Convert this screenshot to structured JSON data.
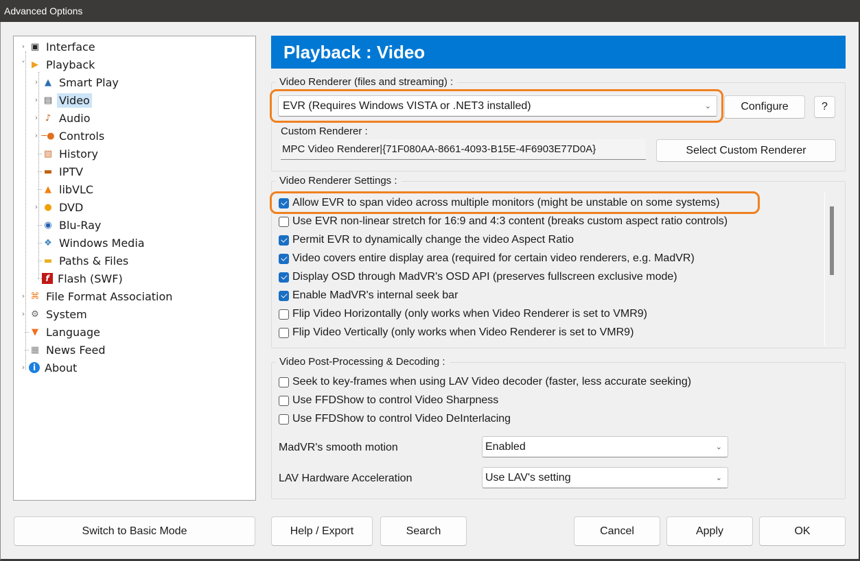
{
  "window": {
    "title": "Advanced Options"
  },
  "tree": {
    "items": [
      {
        "label": "Interface",
        "icon": "interface-icon",
        "level": 0,
        "expander": "collapsed"
      },
      {
        "label": "Playback",
        "icon": "playback-icon",
        "level": 0,
        "expander": "expanded"
      },
      {
        "label": "Smart Play",
        "icon": "smart-play-icon",
        "level": 1,
        "expander": "collapsed"
      },
      {
        "label": "Video",
        "icon": "video-icon",
        "level": 1,
        "expander": "collapsed",
        "selected": true
      },
      {
        "label": "Audio",
        "icon": "audio-icon",
        "level": 1,
        "expander": "collapsed"
      },
      {
        "label": "Controls",
        "icon": "controls-icon",
        "level": 1,
        "expander": "collapsed"
      },
      {
        "label": "History",
        "icon": "history-icon",
        "level": 1,
        "expander": "none"
      },
      {
        "label": "IPTV",
        "icon": "iptv-icon",
        "level": 1,
        "expander": "none"
      },
      {
        "label": "libVLC",
        "icon": "vlc-icon",
        "level": 1,
        "expander": "none"
      },
      {
        "label": "DVD",
        "icon": "dvd-icon",
        "level": 1,
        "expander": "collapsed"
      },
      {
        "label": "Blu-Ray",
        "icon": "bluray-icon",
        "level": 1,
        "expander": "none"
      },
      {
        "label": "Windows Media",
        "icon": "windows-media-icon",
        "level": 1,
        "expander": "none"
      },
      {
        "label": "Paths & Files",
        "icon": "folder-icon",
        "level": 1,
        "expander": "none"
      },
      {
        "label": "Flash (SWF)",
        "icon": "flash-icon",
        "level": 1,
        "expander": "none"
      },
      {
        "label": "File Format Association",
        "icon": "file-association-icon",
        "level": 0,
        "expander": "collapsed"
      },
      {
        "label": "System",
        "icon": "gear-icon",
        "level": 0,
        "expander": "collapsed"
      },
      {
        "label": "Language",
        "icon": "language-icon",
        "level": 0,
        "expander": "none"
      },
      {
        "label": "News Feed",
        "icon": "news-icon",
        "level": 0,
        "expander": "none"
      },
      {
        "label": "About",
        "icon": "info-icon",
        "level": 0,
        "expander": "collapsed"
      }
    ]
  },
  "header": {
    "title": "Playback : Video"
  },
  "renderer": {
    "group_title": "Video Renderer (files and streaming) :",
    "selected": "EVR (Requires Windows VISTA or .NET3 installed)",
    "configure_label": "Configure",
    "help_label": "?",
    "custom_label": "Custom Renderer :",
    "custom_value": "MPC Video Renderer|{71F080AA-8661-4093-B15E-4F6903E77D0A}",
    "select_custom_label": "Select Custom Renderer"
  },
  "renderer_settings": {
    "group_title": "Video Renderer Settings :",
    "options": [
      {
        "label": "Allow EVR to span video across multiple monitors (might be unstable on some systems)",
        "checked": true
      },
      {
        "label": "Use EVR non-linear stretch for 16:9 and 4:3 content (breaks custom aspect ratio controls)",
        "checked": false
      },
      {
        "label": "Permit EVR to dynamically change the video Aspect Ratio",
        "checked": true
      },
      {
        "label": "Video covers entire display area (required for certain video renderers, e.g. MadVR)",
        "checked": true
      },
      {
        "label": "Display OSD through MadVR's OSD API (preserves fullscreen exclusive mode)",
        "checked": true
      },
      {
        "label": "Enable MadVR's internal seek bar",
        "checked": true
      },
      {
        "label": "Flip Video Horizontally (only works when Video Renderer is set to VMR9)",
        "checked": false
      },
      {
        "label": "Flip Video Vertically (only works when Video Renderer is set to VMR9)",
        "checked": false
      }
    ]
  },
  "post_processing": {
    "group_title": "Video Post-Processing & Decoding :",
    "options": [
      {
        "label": "Seek to key-frames when using LAV Video decoder (faster, less accurate seeking)",
        "checked": false
      },
      {
        "label": "Use FFDShow to control Video Sharpness",
        "checked": false
      },
      {
        "label": "Use FFDShow to control Video DeInterlacing",
        "checked": false
      }
    ],
    "smooth_motion_label": "MadVR's smooth motion",
    "smooth_motion_value": "Enabled",
    "lav_hw_label": "LAV Hardware Acceleration",
    "lav_hw_value": "Use LAV's setting"
  },
  "footer": {
    "basic_mode_label": "Switch to Basic Mode",
    "help_export_label": "Help / Export",
    "search_label": "Search",
    "cancel_label": "Cancel",
    "apply_label": "Apply",
    "ok_label": "OK"
  },
  "colors": {
    "accent": "#0078d4",
    "highlight": "#f08020",
    "checkbox": "#1a6fc4",
    "selection": "#cce4f7"
  }
}
